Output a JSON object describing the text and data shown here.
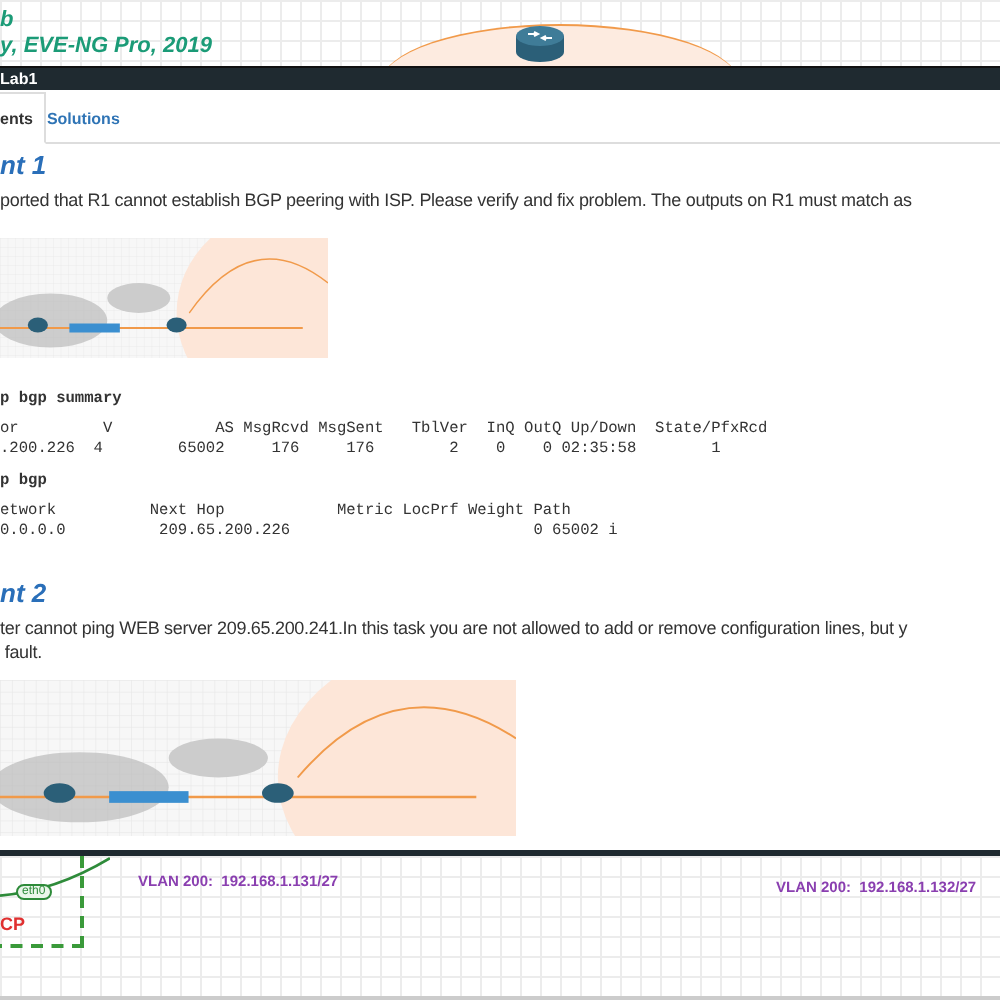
{
  "canvas_top": {
    "caption_lines": [
      "b",
      "y, EVE-NG Pro, 2019"
    ]
  },
  "dialog": {
    "title": "Lab1",
    "tabs": [
      {
        "label": "ents",
        "selected": true
      },
      {
        "label": "Solutions",
        "selected": false
      }
    ],
    "sections": [
      {
        "heading": "nt 1",
        "text": "ported that R1 cannot establish BGP peering with ISP. Please verify and fix problem. The outputs on R1 must match as",
        "output": [
          {
            "kind": "command",
            "text": "p bgp summary"
          },
          {
            "kind": "line",
            "text": "or         V           AS MsgRcvd MsgSent   TblVer  InQ OutQ Up/Down  State/PfxRcd"
          },
          {
            "kind": "line",
            "text": ".200.226  4        65002     176     176        2    0    0 02:35:58        1"
          },
          {
            "kind": "command",
            "text": "p bgp"
          },
          {
            "kind": "line",
            "text": "etwork          Next Hop            Metric LocPrf Weight Path"
          },
          {
            "kind": "line",
            "text": "0.0.0.0          209.65.200.226                          0 65002 i"
          }
        ]
      },
      {
        "heading": "nt 2",
        "text": "ter cannot ping WEB server 209.65.200.241.In this task you are not allowed to add or remove configuration lines, but y\n fault."
      }
    ]
  },
  "canvas_bottom": {
    "vlan_labels": [
      "VLAN 200:  192.168.1.131/27",
      "VLAN 200:  192.168.1.132/27"
    ],
    "link_label": "eth0",
    "zone_label": "CP"
  }
}
